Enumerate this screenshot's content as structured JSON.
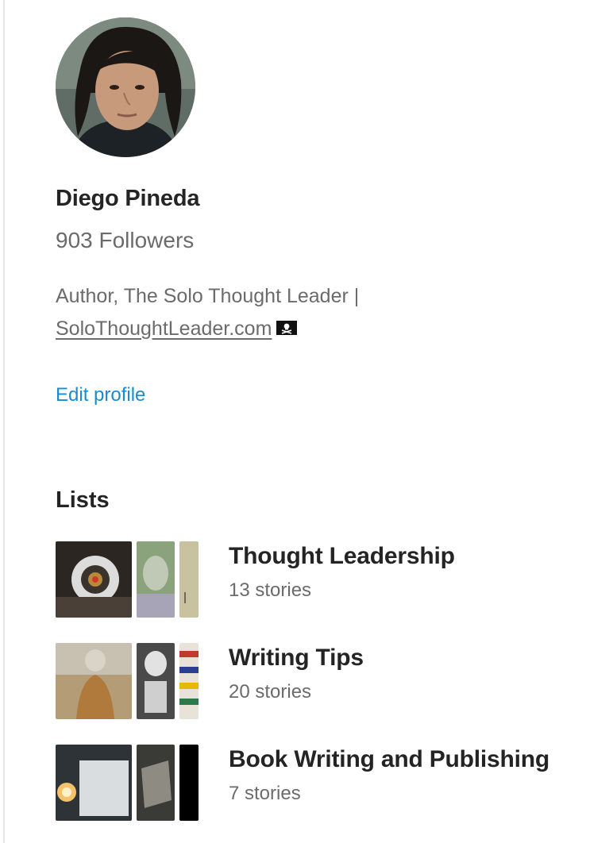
{
  "profile": {
    "name": "Diego Pineda",
    "followers": "903 Followers",
    "bio_text": "Author, The Solo Thought Leader |",
    "bio_link": "SoloThoughtLeader.com",
    "bio_emoji_icon": "pirate-flag-icon",
    "edit_label": "Edit profile"
  },
  "colors": {
    "link": "#1a8bd0",
    "text": "#242424",
    "muted": "#6b6b6b"
  },
  "lists": {
    "heading": "Lists",
    "items": [
      {
        "title": "Thought Leadership",
        "count": "13 stories"
      },
      {
        "title": "Writing Tips",
        "count": "20 stories"
      },
      {
        "title": "Book Writing and Publishing",
        "count": "7 stories"
      }
    ]
  }
}
